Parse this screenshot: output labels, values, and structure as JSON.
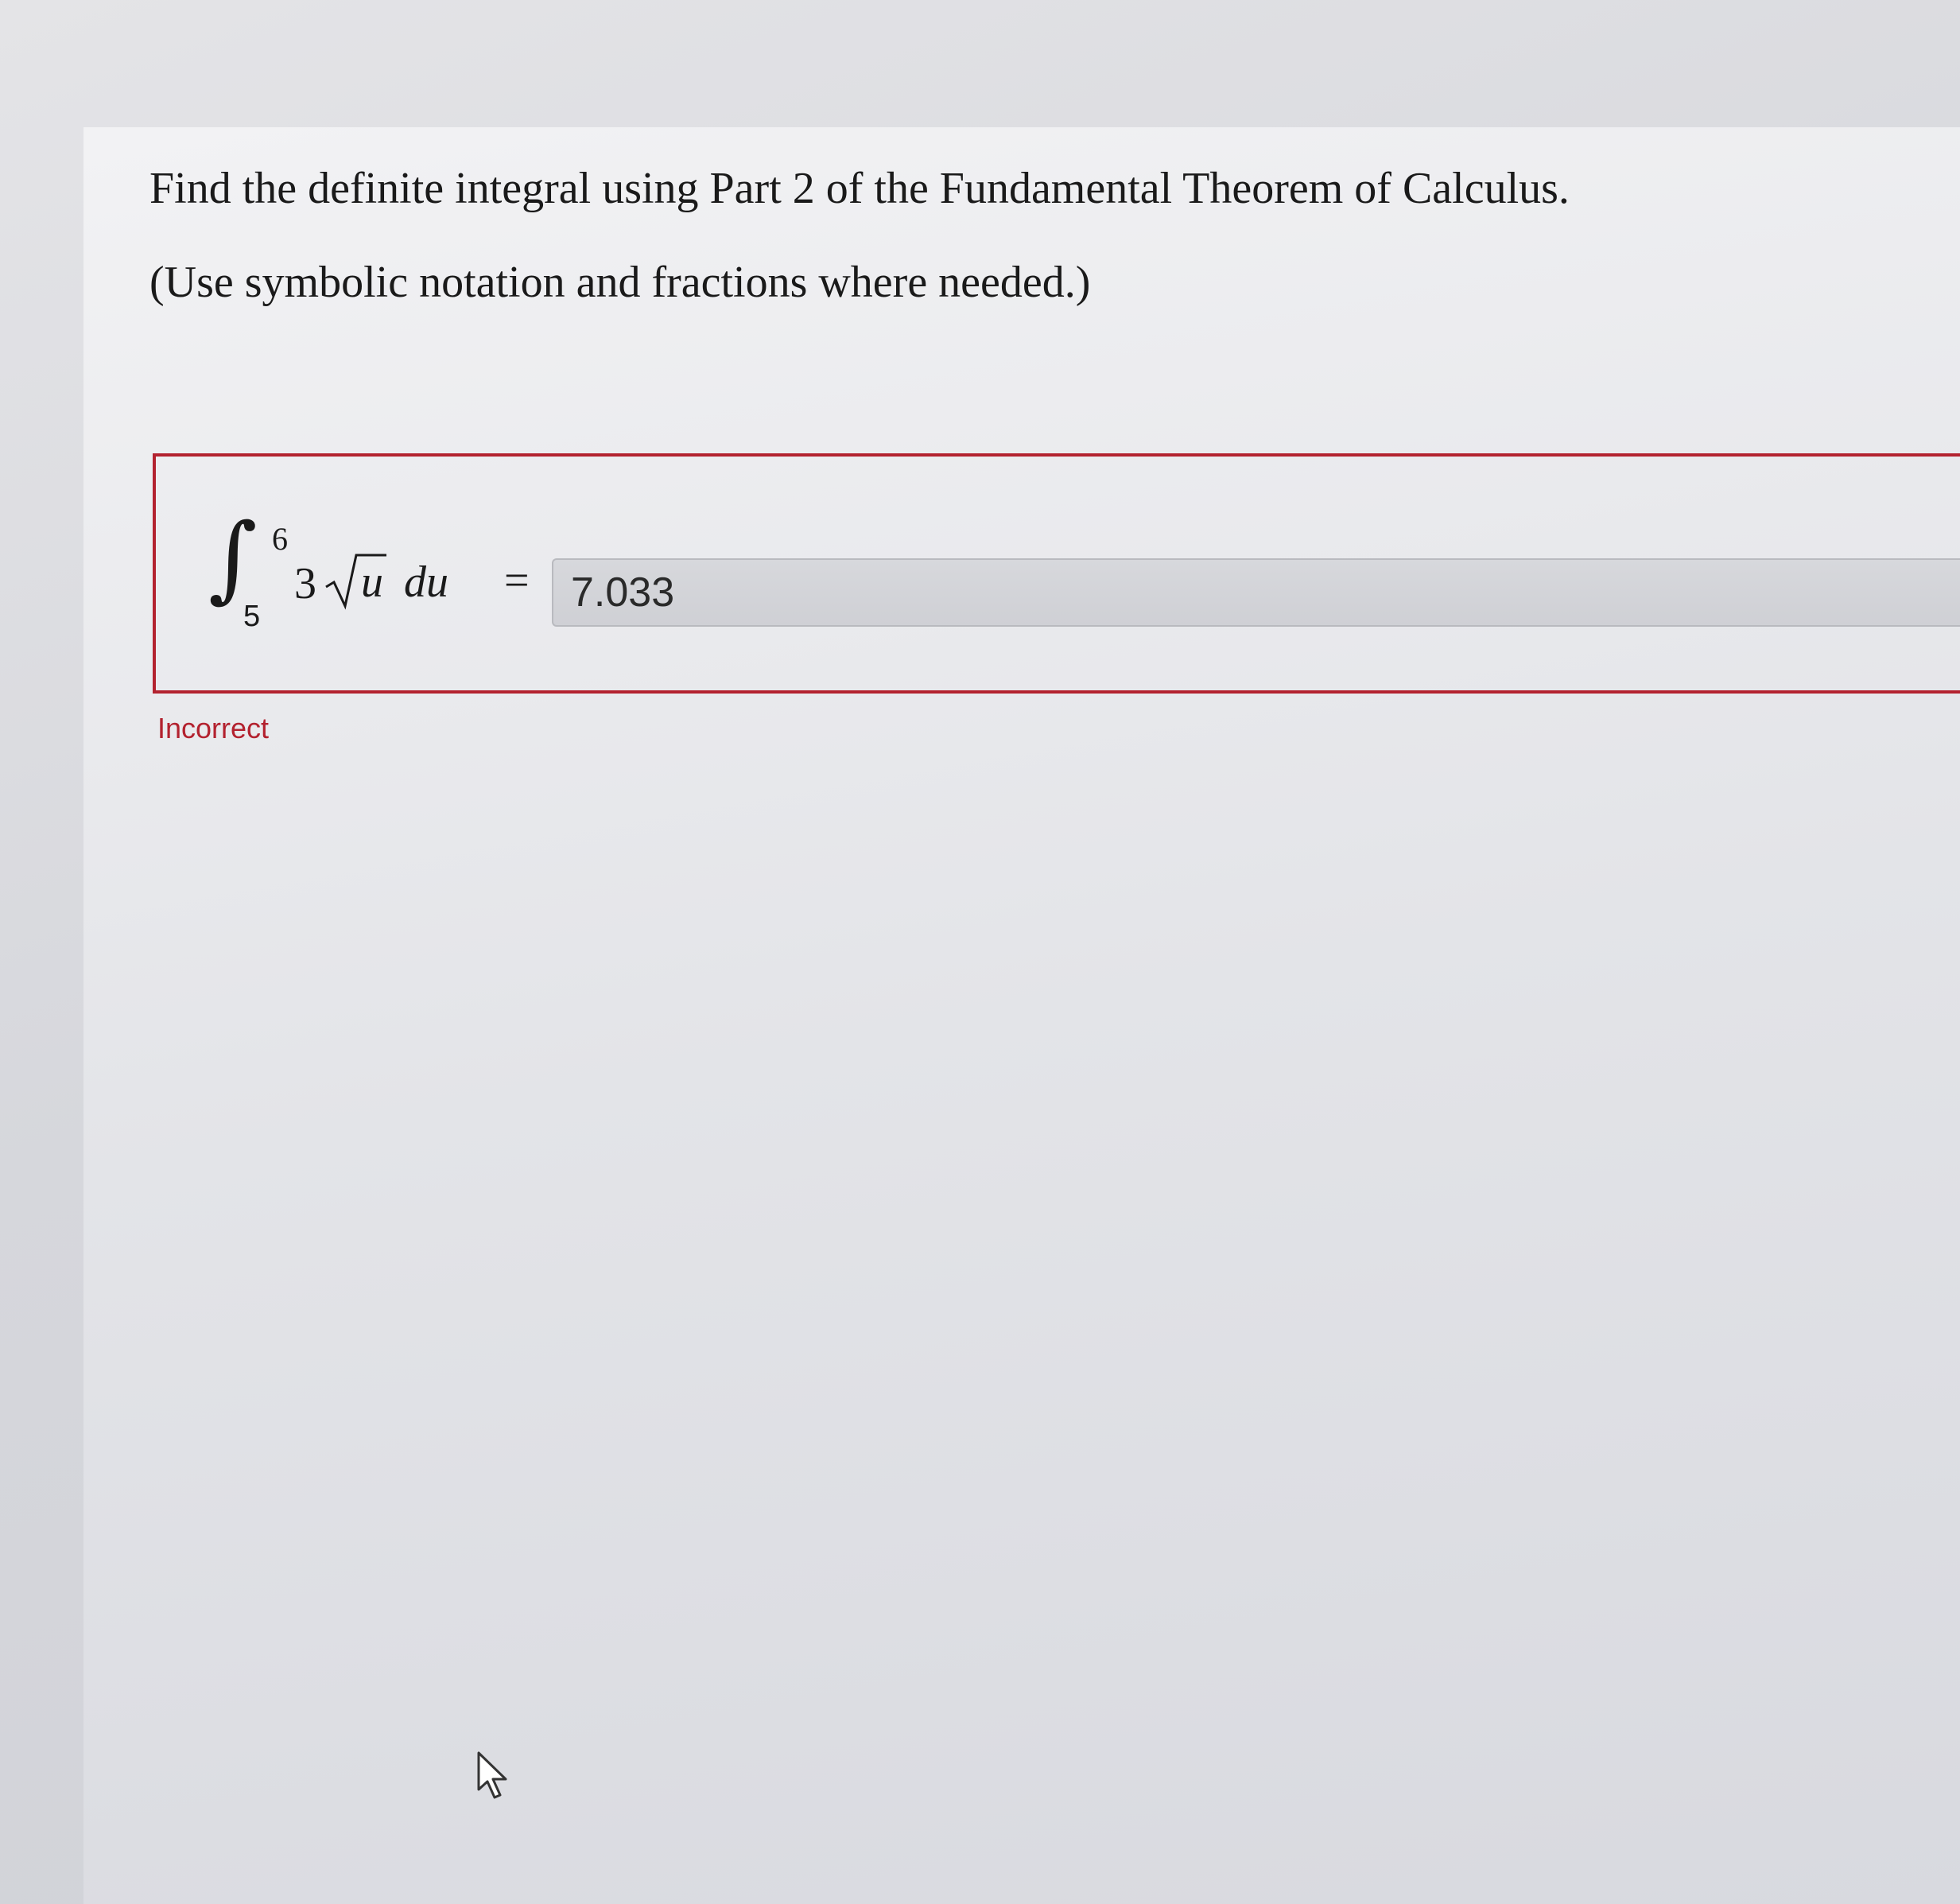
{
  "question": {
    "title": "Find the definite integral using Part 2 of the Fundamental Theorem of Calculus.",
    "hint": "(Use symbolic notation and fractions where needed.)"
  },
  "integral": {
    "upper_limit": "6",
    "lower_limit": "5",
    "coefficient": "3",
    "radicand": "u",
    "differential": "du",
    "equals": "="
  },
  "answer": {
    "value": "7.033"
  },
  "feedback": {
    "text": "Incorrect",
    "color": "#b3222f"
  },
  "icons": {
    "cursor": "mouse-pointer-icon"
  }
}
